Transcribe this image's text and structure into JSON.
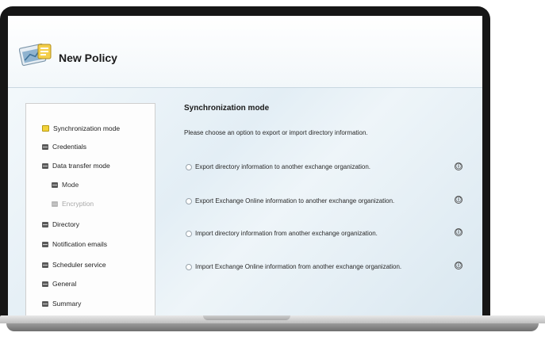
{
  "window": {
    "title": "New Policy"
  },
  "sidebar": {
    "items": [
      {
        "label": "Synchronization mode",
        "state": "active"
      },
      {
        "label": "Credentials"
      },
      {
        "label": "Data transfer mode"
      },
      {
        "label": "Mode",
        "sub": true
      },
      {
        "label": "Encryption",
        "sub": true,
        "state": "disabled"
      },
      {
        "label": "Directory"
      },
      {
        "label": "Notification emails"
      },
      {
        "label": "Scheduler service"
      },
      {
        "label": "General"
      },
      {
        "label": "Summary"
      }
    ]
  },
  "main": {
    "heading": "Synchronization mode",
    "description": "Please choose an option to export or import directory information.",
    "options": [
      {
        "label": "Export directory information to another exchange organization.",
        "selected": false
      },
      {
        "label": "Export Exchange Online information to another exchange organization.",
        "selected": false
      },
      {
        "label": "Import directory information from another exchange organization.",
        "selected": false
      },
      {
        "label": "Import Exchange Online information from another exchange organization.",
        "selected": false
      }
    ],
    "info_glyph": "ⓘ"
  },
  "colors": {
    "active_marker": "#f2d23a",
    "bezel": "#161616",
    "panel_bg": "#e3eef5"
  }
}
